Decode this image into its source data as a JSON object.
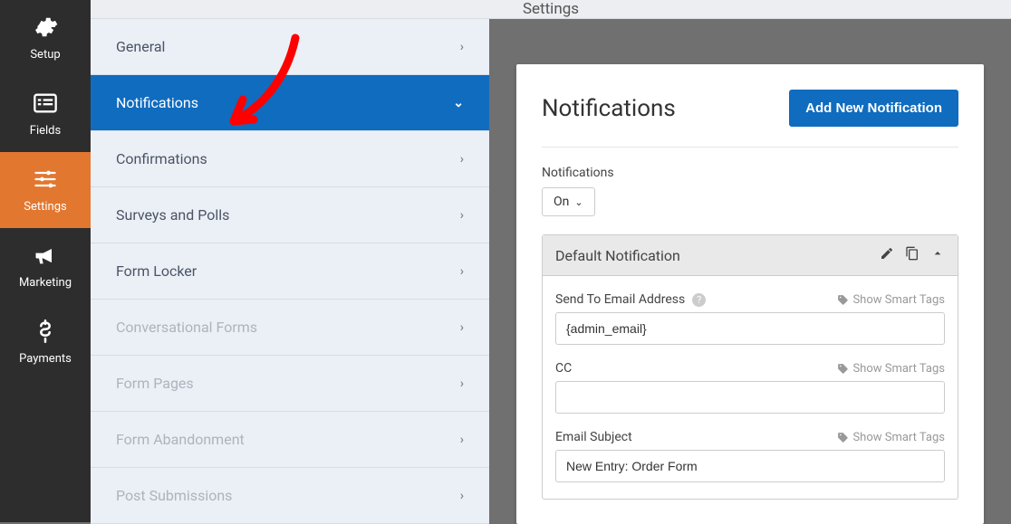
{
  "sidebar": {
    "items": [
      {
        "label": "Setup"
      },
      {
        "label": "Fields"
      },
      {
        "label": "Settings"
      },
      {
        "label": "Marketing"
      },
      {
        "label": "Payments"
      }
    ]
  },
  "header": {
    "title": "Settings"
  },
  "submenu": {
    "items": [
      {
        "label": "General"
      },
      {
        "label": "Notifications"
      },
      {
        "label": "Confirmations"
      },
      {
        "label": "Surveys and Polls"
      },
      {
        "label": "Form Locker"
      },
      {
        "label": "Conversational Forms"
      },
      {
        "label": "Form Pages"
      },
      {
        "label": "Form Abandonment"
      },
      {
        "label": "Post Submissions"
      }
    ]
  },
  "panel": {
    "title": "Notifications",
    "add_button": "Add New Notification",
    "notif_label": "Notifications",
    "on_value": "On",
    "card_title": "Default Notification",
    "sendto_label": "Send To Email Address",
    "sendto_value": "{admin_email}",
    "cc_label": "CC",
    "cc_value": "",
    "subject_label": "Email Subject",
    "subject_value": "New Entry: Order Form",
    "smart_tags": "Show Smart Tags"
  }
}
